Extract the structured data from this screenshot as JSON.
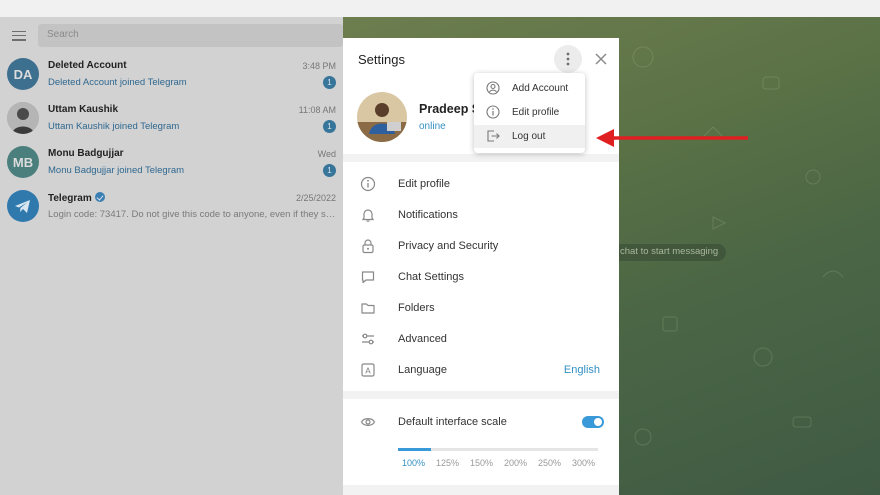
{
  "chat_list": {
    "search_placeholder": "Search",
    "chats": [
      {
        "name": "Deleted Account",
        "time": "3:48 PM",
        "preview": "Deleted Account joined Telegram",
        "initials": "DA",
        "unread": "1",
        "avatar_color": "#3d6f8e"
      },
      {
        "name": "Uttam Kaushik",
        "time": "11:08 AM",
        "preview": "Uttam Kaushik joined Telegram",
        "unread": "1"
      },
      {
        "name": "Monu Badgujjar",
        "time": "Wed",
        "preview": "Monu Badgujjar joined Telegram",
        "initials": "MB",
        "unread": "1",
        "avatar_color": "#4b7f7d"
      },
      {
        "name": "Telegram",
        "time": "2/25/2022",
        "preview": "Login code: 73417. Do not give this code to anyone, even if they say..."
      }
    ]
  },
  "chat_area": {
    "hint": "chat to start messaging"
  },
  "settings": {
    "title": "Settings",
    "profile_name": "Pradeep S",
    "profile_status": "online",
    "items": [
      {
        "label": "Edit profile",
        "icon": "info-icon"
      },
      {
        "label": "Notifications",
        "icon": "bell-icon"
      },
      {
        "label": "Privacy and Security",
        "icon": "lock-icon"
      },
      {
        "label": "Chat Settings",
        "icon": "chat-bubble-icon"
      },
      {
        "label": "Folders",
        "icon": "folder-icon"
      },
      {
        "label": "Advanced",
        "icon": "sliders-icon"
      },
      {
        "label": "Language",
        "icon": "language-icon",
        "value": "English"
      }
    ],
    "scale_label": "Default interface scale",
    "scale_toggle_on": true,
    "scale_options": [
      "100%",
      "125%",
      "150%",
      "200%",
      "250%",
      "300%"
    ],
    "scale_selected": "100%"
  },
  "popup_menu": {
    "items": [
      {
        "label": "Add Account",
        "icon": "add-account-icon"
      },
      {
        "label": "Edit profile",
        "icon": "info-icon"
      },
      {
        "label": "Log out",
        "icon": "logout-icon"
      }
    ]
  },
  "colors": {
    "accent": "#3390c3",
    "annotation_arrow": "#e02020"
  }
}
